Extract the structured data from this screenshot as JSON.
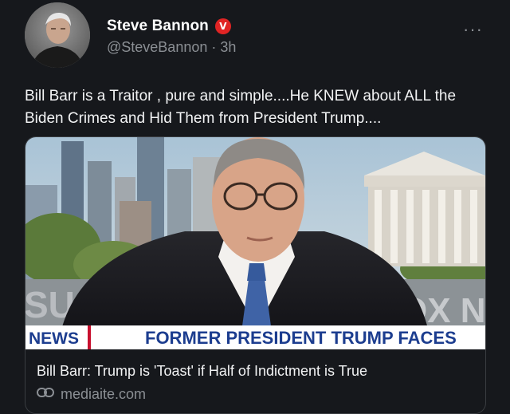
{
  "author": {
    "display_name": "Steve Bannon",
    "verified_badge": "V",
    "handle": "@SteveBannon",
    "separator": "·",
    "time": "3h"
  },
  "more_icon": "···",
  "post": {
    "text": "Bill Barr is a Traitor , pure and simple....He KNEW about ALL the Biden Crimes and Hid Them from President Trump...."
  },
  "link_card": {
    "chyron_label": "NEWS",
    "chyron_headline": "FORMER PRESIDENT TRUMP FACES",
    "bg_sign_left": "SU",
    "bg_sign_right": "OX NE",
    "title": "Bill Barr: Trump is 'Toast' if Half of Indictment is True",
    "domain": "mediaite.com",
    "link_icon": "link-icon"
  },
  "colors": {
    "background": "#16181c",
    "verified": "#e02424",
    "chyron_blue": "#1c3d8f"
  }
}
